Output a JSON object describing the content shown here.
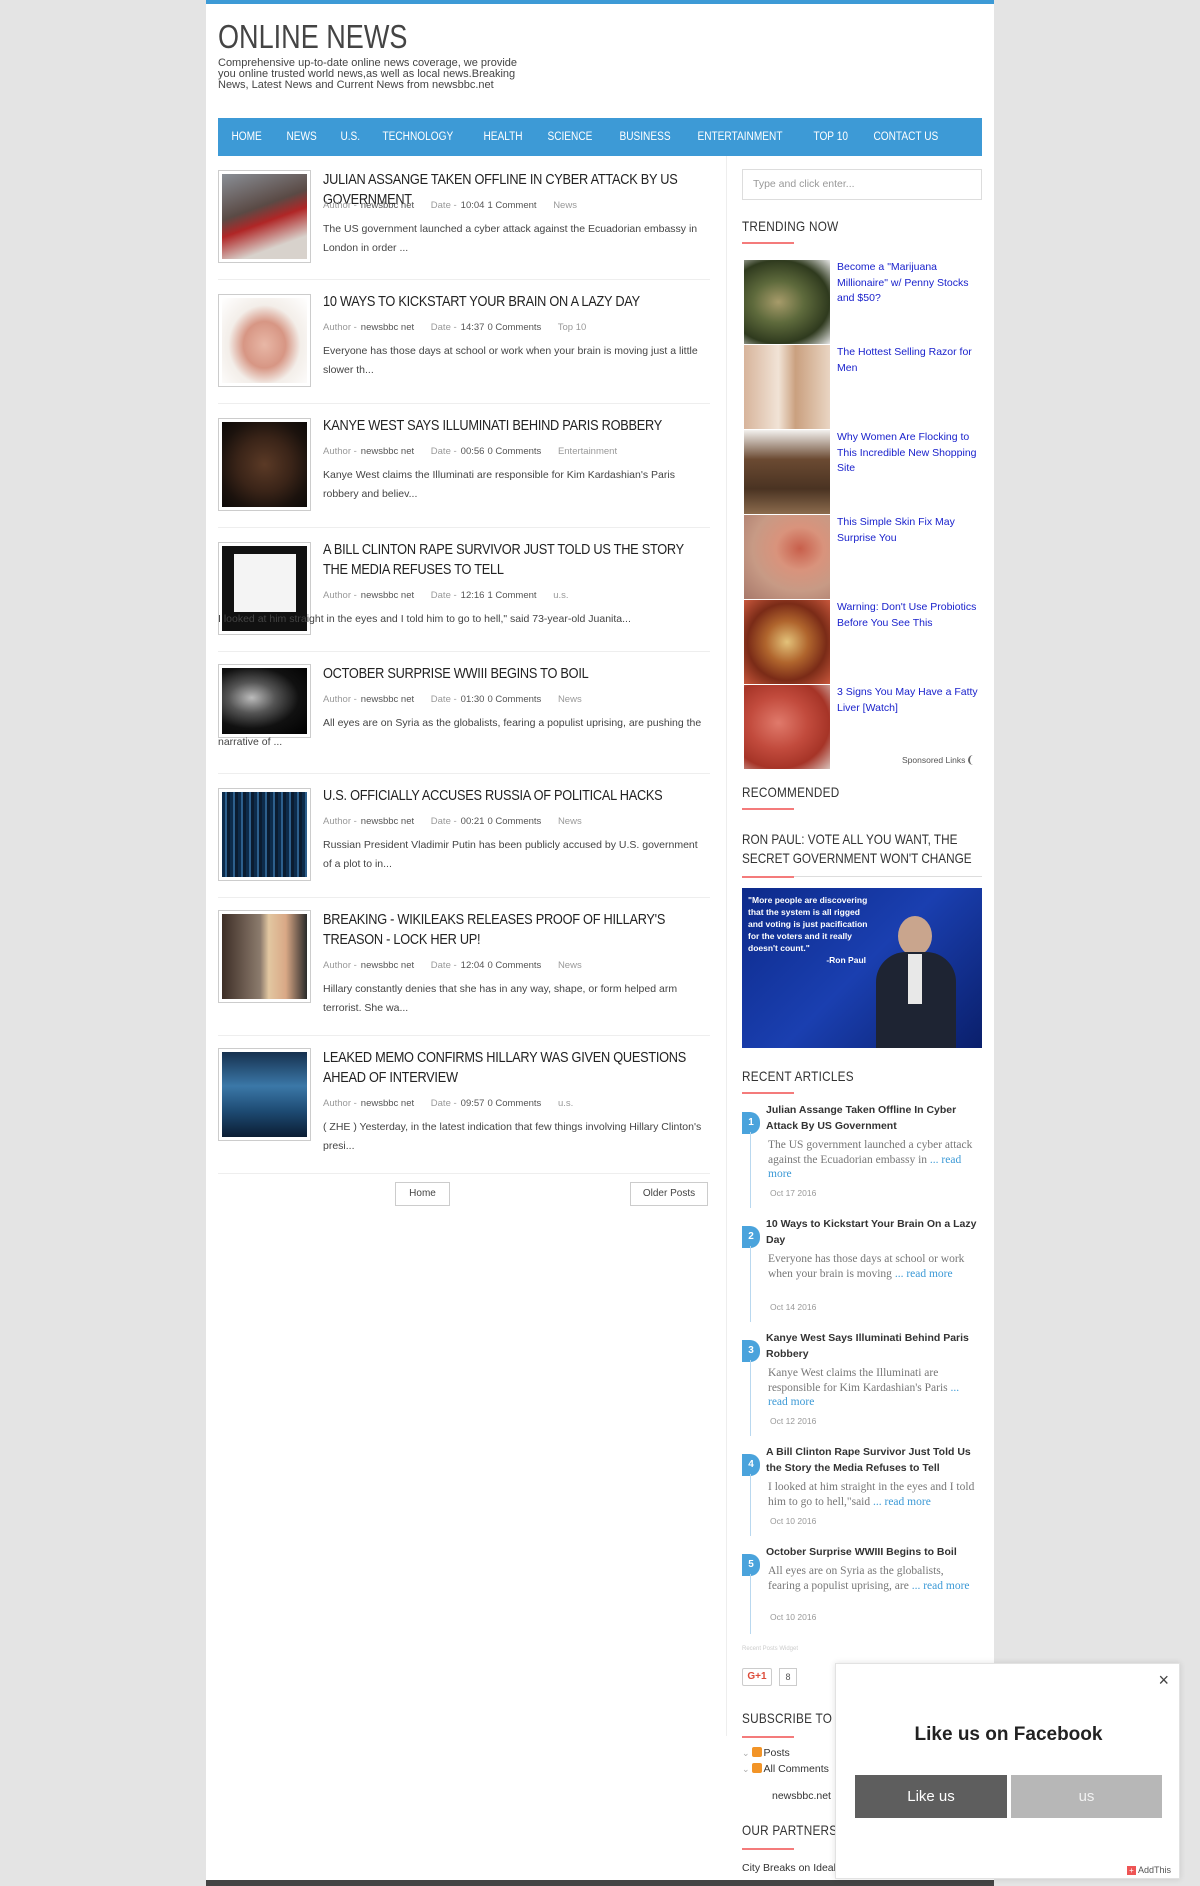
{
  "header": {
    "title": "ONLINE NEWS",
    "description": "Comprehensive up-to-date online news coverage, we provide you online trusted world news,as well as local news.Breaking News, Latest News and Current News from newsbbc.net"
  },
  "nav": [
    "HOME",
    "NEWS",
    "U.S.",
    "TECHNOLOGY",
    "HEALTH",
    "SCIENCE",
    "BUSINESS",
    "ENTERTAINMENT",
    "TOP 10",
    "CONTACT US"
  ],
  "posts": [
    {
      "title": "JULIAN ASSANGE TAKEN OFFLINE IN CYBER ATTACK BY US GOVERNMENT",
      "author_label": "Author -",
      "author": "newsbbc net",
      "date_label": "Date -",
      "date": "10:04",
      "comments": "1 Comment",
      "category": "News",
      "excerpt": "The US government launched a cyber attack against the Ecuadorian embassy in London in order ...",
      "thumb": "assange-photo"
    },
    {
      "title": "10 WAYS TO KICKSTART YOUR BRAIN ON A LAZY DAY",
      "author_label": "Author -",
      "author": "newsbbc net",
      "date_label": "Date -",
      "date": "14:37",
      "comments": "0 Comments",
      "category": "Top 10",
      "excerpt": "Everyone has those days at  school  or work when your brain is moving just a little slower th...",
      "thumb": "brain-photo"
    },
    {
      "title": "KANYE WEST SAYS ILLUMINATI BEHIND PARIS ROBBERY",
      "author_label": "Author -",
      "author": "newsbbc net",
      "date_label": "Date -",
      "date": "00:56",
      "comments": "0 Comments",
      "category": "Entertainment",
      "excerpt": "Kanye West claims the Illuminati are responsible for Kim Kardashian's Paris robbery and believ...",
      "thumb": "kanye-photo"
    },
    {
      "title": "A BILL CLINTON RAPE SURVIVOR JUST TOLD US THE STORY THE MEDIA REFUSES TO TELL",
      "author_label": "Author -",
      "author": "newsbbc net",
      "date_label": "Date -",
      "date": "12:16",
      "comments": "1 Comment",
      "category": "u.s.",
      "excerpt": "I looked at him straight in the eyes and I told him to go to hell,\" said 73-year-old Juanita...",
      "thumb": "tweet-screenshot"
    },
    {
      "title": "OCTOBER SURPRISE WWIII BEGINS TO BOIL",
      "author_label": "Author -",
      "author": "newsbbc net",
      "date_label": "Date -",
      "date": "01:30",
      "comments": "0 Comments",
      "category": "News",
      "excerpt": "All eyes are on Syria as the globalists, fearing a populist uprising, are pushing the narrative of ...",
      "thumb": "skull-photo"
    },
    {
      "title": "U.S. OFFICIALLY ACCUSES RUSSIA OF POLITICAL HACKS",
      "author_label": "Author -",
      "author": "newsbbc net",
      "date_label": "Date -",
      "date": "00:21",
      "comments": "0 Comments",
      "category": "News",
      "excerpt": "Russian President Vladimir Putin has been publicly accused by U.S. government of a plot to in...",
      "thumb": "hacker-photo"
    },
    {
      "title": "BREAKING - WIKILEAKS RELEASES PROOF OF HILLARY'S TREASON - LOCK HER UP!",
      "author_label": "Author -",
      "author": "newsbbc net",
      "date_label": "Date -",
      "date": "12:04",
      "comments": "0 Comments",
      "category": "News",
      "excerpt": "Hillary constantly denies that she has in any way, shape, or form helped arm terrorist. She wa...",
      "thumb": "assange-hillary-photo"
    },
    {
      "title": "LEAKED MEMO CONFIRMS HILLARY WAS GIVEN QUESTIONS AHEAD OF INTERVIEW",
      "author_label": "Author -",
      "author": "newsbbc net",
      "date_label": "Date -",
      "date": "09:57",
      "comments": "0 Comments",
      "category": "u.s.",
      "excerpt": "( ZHE )  Yesterday, in the latest indication that few things involving Hillary Clinton's presi...",
      "thumb": "steve-harvey-photo"
    }
  ],
  "pager": {
    "home": "Home",
    "older": "Older Posts"
  },
  "sidebar": {
    "search_placeholder": "Type and click enter...",
    "trending_heading": "TRENDING NOW",
    "trending": [
      {
        "text": "Become a \"Marijuana Millionaire\" w/ Penny Stocks and $50?",
        "thumb": "marijuana-photo"
      },
      {
        "text": "The Hottest Selling Razor for Men",
        "thumb": "shaving-photo"
      },
      {
        "text": "Why Women Are Flocking to This Incredible New Shopping Site",
        "thumb": "handbag-photo"
      },
      {
        "text": "This Simple Skin Fix May Surprise You",
        "thumb": "skin-photo"
      },
      {
        "text": "Warning: Don't Use Probiotics Before You See This",
        "thumb": "probiotics-photo"
      },
      {
        "text": "3 Signs You May Have a Fatty Liver [Watch]",
        "thumb": "liver-photo"
      }
    ],
    "sponsored": "Sponsored Links",
    "recommended_heading": "RECOMMENDED",
    "recommended_title": "RON PAUL: VOTE ALL YOU WANT, THE SECRET GOVERNMENT WON'T CHANGE",
    "recommended_quote": "\"More people are discovering that the system is all rigged and voting is just pacification for the voters and it really doesn't count.\"",
    "recommended_attrib": "-Ron Paul",
    "recent_heading": "RECENT ARTICLES",
    "recent": [
      {
        "num": "1",
        "title": "Julian Assange Taken Offline In Cyber Attack By US Government",
        "text": "The US government launched a cyber attack against the Ecuadorian embassy in",
        "more": "... read more",
        "date": "Oct 17 2016"
      },
      {
        "num": "2",
        "title": "10 Ways to Kickstart Your Brain On a Lazy Day",
        "text": "Everyone has those days at school or work when your brain is moving",
        "more": "... read more",
        "date": "Oct 14 2016"
      },
      {
        "num": "3",
        "title": "Kanye West Says Illuminati Behind Paris Robbery",
        "text": "Kanye West claims the Illuminati are responsible for Kim Kardashian's Paris",
        "more": "... read more",
        "date": "Oct 12 2016"
      },
      {
        "num": "4",
        "title": "A Bill Clinton Rape Survivor Just Told Us the Story the Media Refuses to Tell",
        "text": "I looked at him straight in the eyes and I told him to go to hell,\"said",
        "more": "... read more",
        "date": "Oct 10 2016"
      },
      {
        "num": "5",
        "title": "October Surprise WWIII Begins to Boil",
        "text": "All eyes are on Syria as the globalists, fearing a populist uprising, are",
        "more": "... read more",
        "date": "Oct 10 2016"
      }
    ],
    "recent_widget_label": "Recent Posts Widget",
    "gplus_label": "G+1",
    "gplus_count": "8",
    "subscribe_heading": "SUBSCRIBE TO",
    "subscribe_posts": "Posts",
    "subscribe_comments": "All Comments",
    "subscribe_site": "newsbbc.net",
    "partners_heading": "OUR PARTNERS",
    "partners_link": "City Breaks on Ideal"
  },
  "facebook_popup": {
    "title": "Like us on Facebook",
    "like_button": "Like us",
    "second_button": "us",
    "close": "×",
    "brand": "AddThis"
  }
}
